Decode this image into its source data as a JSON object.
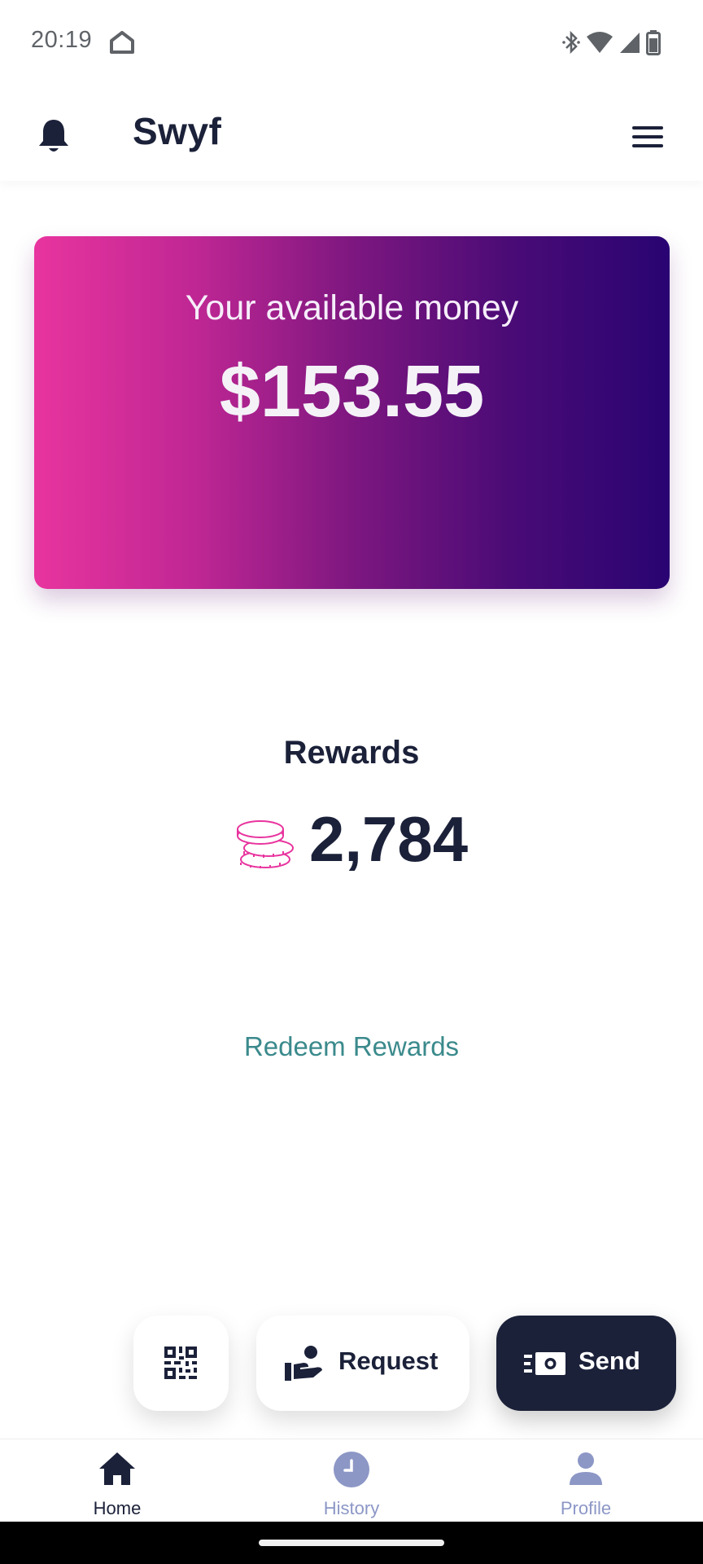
{
  "status_bar": {
    "time": "20:19",
    "icons": [
      "home-icon",
      "bluetooth-icon",
      "wifi-icon",
      "signal-icon",
      "battery-icon"
    ]
  },
  "header": {
    "title": "Swyf",
    "left_icon": "bell-icon",
    "right_icon": "menu-icon"
  },
  "balance_card": {
    "label": "Your available money",
    "amount": "$153.55",
    "gradient": [
      "#e8349e",
      "#290472"
    ]
  },
  "rewards": {
    "title": "Rewards",
    "points": "2,784",
    "icon": "coins-icon",
    "redeem_label": "Redeem Rewards"
  },
  "actions": {
    "qr_icon": "qr-code-icon",
    "request_label": "Request",
    "send_label": "Send"
  },
  "bottom_nav": {
    "items": [
      {
        "label": "Home",
        "icon": "home-icon",
        "active": true
      },
      {
        "label": "History",
        "icon": "clock-icon",
        "active": false
      },
      {
        "label": "Profile",
        "icon": "person-icon",
        "active": false
      }
    ]
  },
  "colors": {
    "primary_dark": "#1b2139",
    "accent_teal": "#3b8a8c",
    "coins_pink": "#e8349e",
    "nav_inactive": "#8c97c6"
  }
}
